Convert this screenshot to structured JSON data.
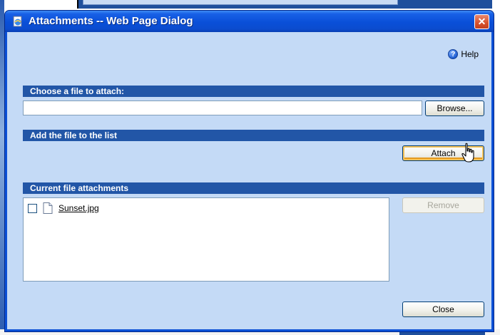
{
  "dialog": {
    "title": "Attachments -- Web Page Dialog",
    "close_glyph": "✕",
    "help_label": "Help",
    "help_glyph": "?",
    "title_icon": "ie-page-icon"
  },
  "sections": {
    "choose": "Choose a file to attach:",
    "add": "Add the file to the list",
    "current": "Current file attachments"
  },
  "file_input": {
    "value": "",
    "placeholder": ""
  },
  "buttons": {
    "browse": "Browse...",
    "attach": "Attach",
    "remove": "Remove",
    "close": "Close"
  },
  "attachments": [
    {
      "name": "Sunset.jpg",
      "checked": false
    }
  ],
  "colors": {
    "title_bar": "#0a4fd8",
    "client_bg": "#c4daf6",
    "section_header": "#2256a7",
    "close_button": "#d6502b"
  }
}
